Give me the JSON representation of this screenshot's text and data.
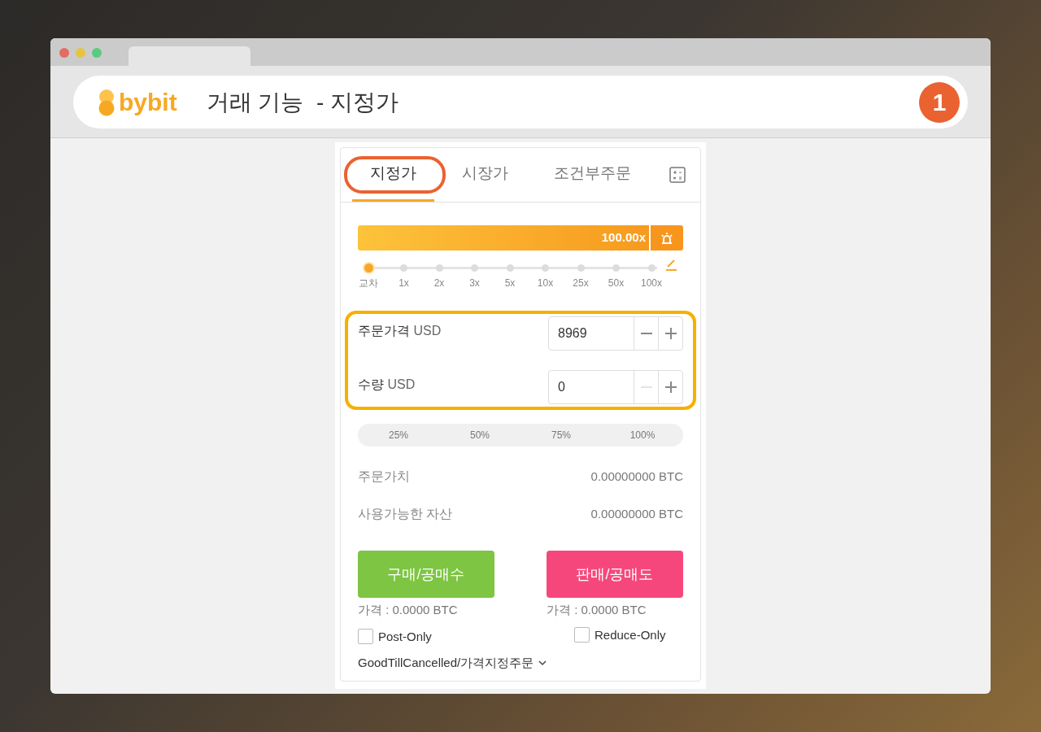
{
  "header": {
    "logo": "bybit",
    "title": "거래 기능  - 지정가",
    "step_badge": "1"
  },
  "tabs": [
    {
      "label": "지정가",
      "selected": true
    },
    {
      "label": "시장가",
      "selected": false
    },
    {
      "label": "조건부주문",
      "selected": false
    }
  ],
  "leverage": {
    "reading": "100.00x",
    "level": 1.0
  },
  "leverage_stops": [
    {
      "label": "교차",
      "selected": true
    },
    {
      "label": "1x",
      "selected": false
    },
    {
      "label": "2x",
      "selected": false
    },
    {
      "label": "3x",
      "selected": false
    },
    {
      "label": "5x",
      "selected": false
    },
    {
      "label": "10x",
      "selected": false
    },
    {
      "label": "25x",
      "selected": false
    },
    {
      "label": "50x",
      "selected": false
    },
    {
      "label": "100x",
      "selected": false
    }
  ],
  "fields": [
    {
      "label": "주문가격",
      "unit": "USD",
      "value": "8969",
      "minus_disabled": false
    },
    {
      "label": "수량",
      "unit": "USD",
      "value": "0",
      "minus_disabled": true
    }
  ],
  "percent_buttons": [
    "25%",
    "50%",
    "75%",
    "100%"
  ],
  "summary": [
    {
      "label": "주문가치",
      "value": "0.00000000 BTC"
    },
    {
      "label": "사용가능한 자산",
      "value": "0.00000000 BTC"
    }
  ],
  "actions": [
    {
      "kind": "buy",
      "label": "구매/공매수",
      "price": "가격 : 0.0000 BTC",
      "option": {
        "label": "Post-Only",
        "checked": false
      }
    },
    {
      "kind": "sell",
      "label": "판매/공매도",
      "price": "가격 : 0.0000 BTC",
      "option": {
        "label": "Reduce-Only",
        "checked": false
      }
    }
  ],
  "time_in_force": "GoodTillCancelled/가격지정주문"
}
